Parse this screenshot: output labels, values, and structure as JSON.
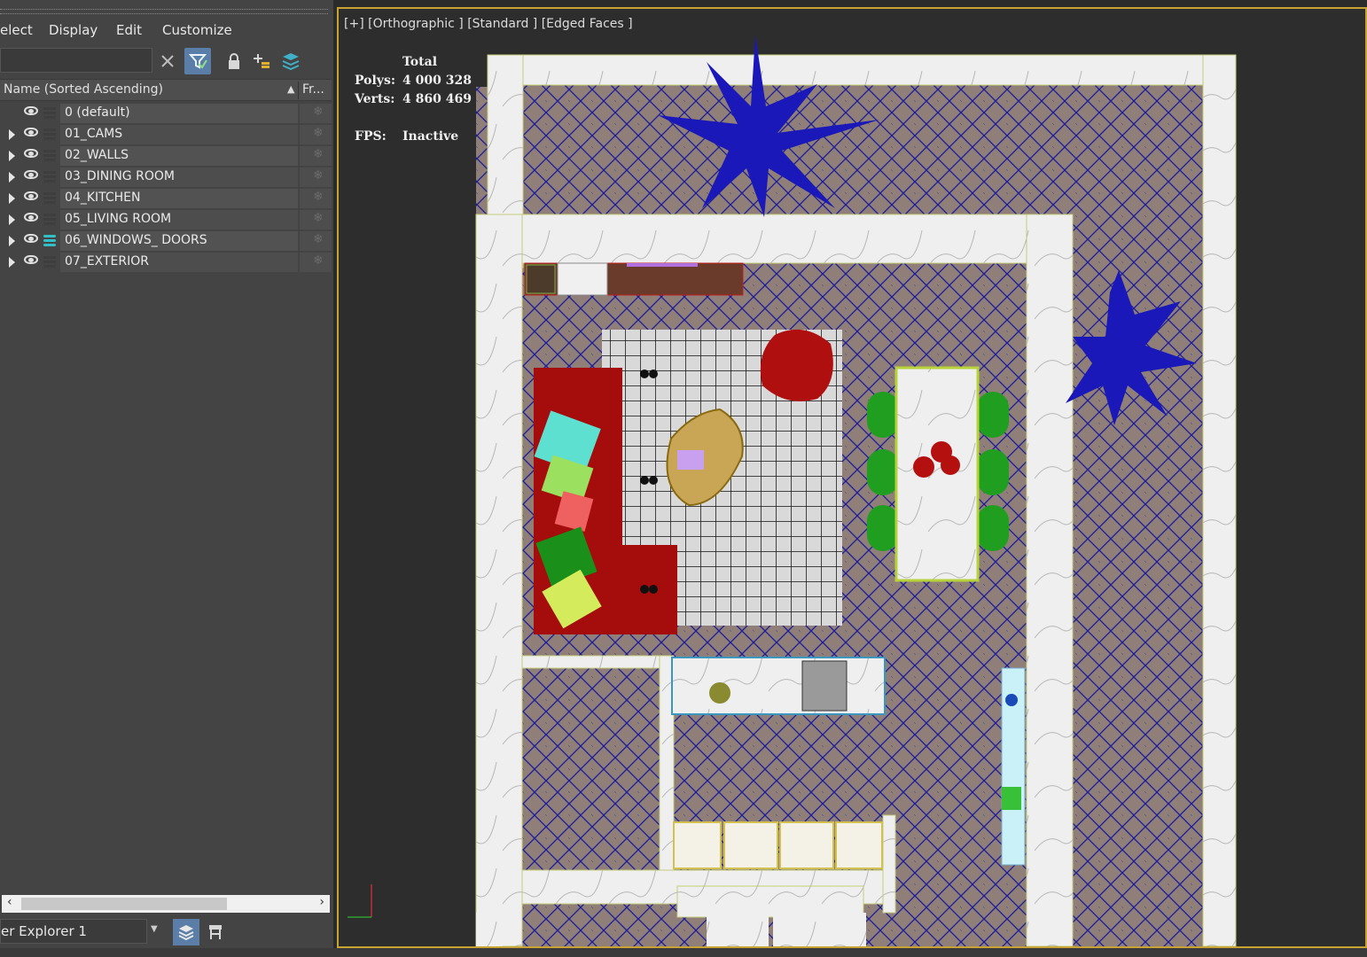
{
  "menu": {
    "select": "elect",
    "display": "Display",
    "edit": "Edit",
    "customize": "Customize"
  },
  "toolbar": {
    "search_value": "",
    "icons": [
      "close-icon",
      "filter-icon",
      "lock-icon",
      "add-layer-icon",
      "layers-icon"
    ]
  },
  "columns": {
    "name": "Name (Sorted Ascending)",
    "frozen": "Fr..."
  },
  "layers": [
    {
      "name": "0 (default)",
      "expandable": false,
      "active": false
    },
    {
      "name": "01_CAMS",
      "expandable": true,
      "active": false
    },
    {
      "name": "02_WALLS",
      "expandable": true,
      "active": false
    },
    {
      "name": "03_DINING ROOM",
      "expandable": true,
      "active": false
    },
    {
      "name": "04_KITCHEN",
      "expandable": true,
      "active": false
    },
    {
      "name": "05_LIVING ROOM",
      "expandable": true,
      "active": false
    },
    {
      "name": "06_WINDOWS_ DOORS",
      "expandable": true,
      "active": true
    },
    {
      "name": "07_EXTERIOR",
      "expandable": true,
      "active": false
    }
  ],
  "explorer": {
    "name": "er Explorer 1"
  },
  "viewport": {
    "label": "[+] [Orthographic ] [Standard ] [Edged Faces ]",
    "stats_title": "Total",
    "polys_label": "Polys:",
    "polys_value": "4 000 328",
    "verts_label": "Verts:",
    "verts_value": "4 860 469",
    "fps_label": "FPS:",
    "fps_value": "Inactive"
  },
  "colors": {
    "panel": "#444444",
    "viewport_bg": "#2d2d2d",
    "viewport_border": "#c8a232",
    "active_button": "#5b7ea8",
    "floor": "#8f7f78",
    "wall": "#eeeeee",
    "plant": "#1a18b8",
    "sofa": "#a50d0d",
    "chair": "#1f9e1f"
  }
}
